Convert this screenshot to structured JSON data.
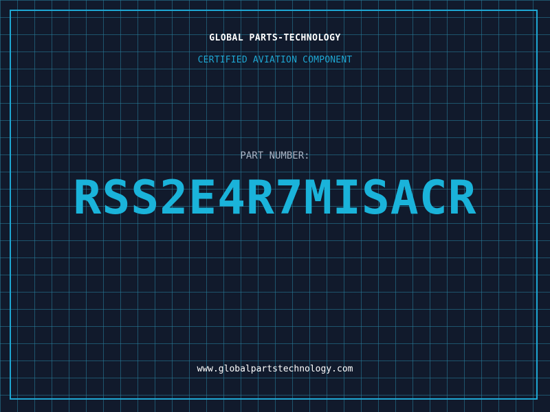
{
  "header": {
    "company": "GLOBAL PARTS-TECHNOLOGY",
    "subtitle": "CERTIFIED AVIATION COMPONENT"
  },
  "part": {
    "label": "PART NUMBER:",
    "number": "RSS2E4R7MISACR"
  },
  "footer": {
    "website": "www.globalpartstechnology.com"
  },
  "colors": {
    "background": "#111a2c",
    "accent": "#1ea7d3",
    "text": "#ffffff",
    "muted": "#aab4c4"
  }
}
